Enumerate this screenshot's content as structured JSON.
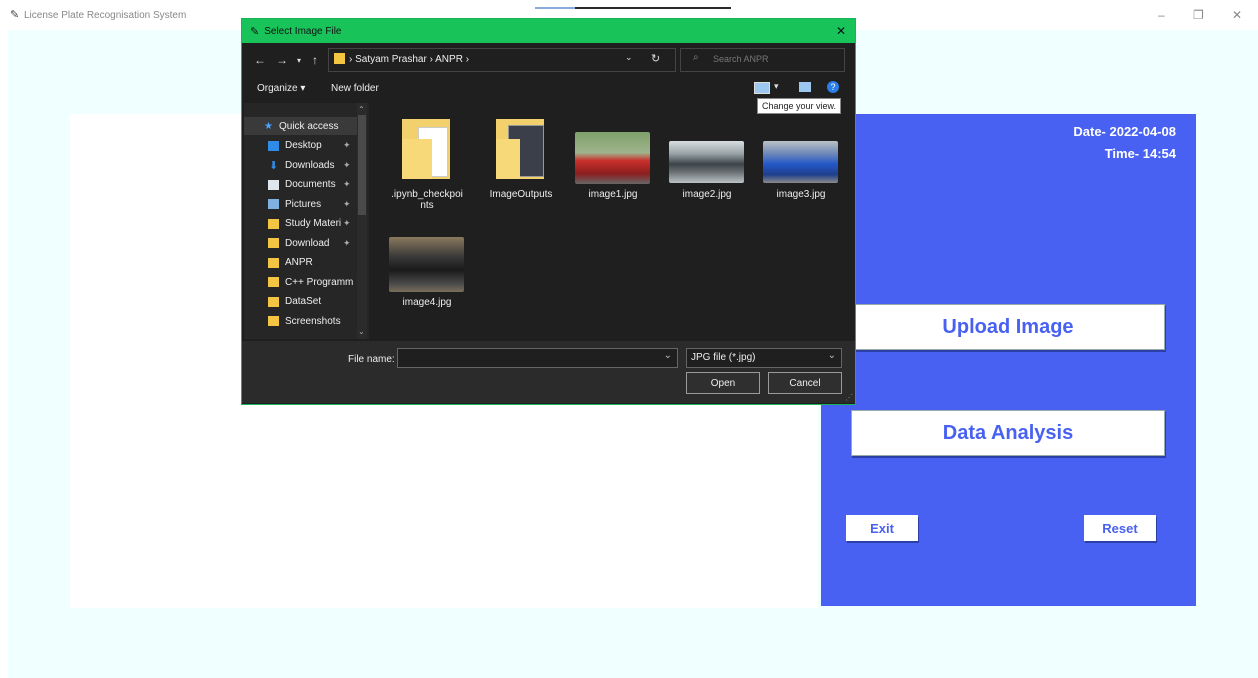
{
  "app": {
    "title": "License Plate Recognisation System",
    "win_controls": {
      "minimize": "–",
      "maximize": "❐",
      "close": "✕"
    }
  },
  "panel": {
    "date": "Date- 2022-04-08",
    "time": "Time- 14:54",
    "upload_label": "Upload Image",
    "analysis_label": "Data Analysis",
    "exit_label": "Exit",
    "reset_label": "Reset",
    "accent": "#4961f2"
  },
  "dialog": {
    "title": "Select Image File",
    "breadcrumb": "›  Satyam Prashar  ›  ANPR  ›",
    "search_placeholder": "Search ANPR",
    "toolbar": {
      "organize": "Organize ▾",
      "new_folder": "New folder"
    },
    "tooltip": "Change your view.",
    "nav_items": [
      {
        "label": "Quick access",
        "icon": "star-icon"
      },
      {
        "label": "Desktop",
        "icon": "desktop-icon"
      },
      {
        "label": "Downloads",
        "icon": "download-icon"
      },
      {
        "label": "Documents",
        "icon": "document-icon"
      },
      {
        "label": "Pictures",
        "icon": "pictures-icon"
      },
      {
        "label": "Study Materi",
        "icon": "folder-icon"
      },
      {
        "label": "Download",
        "icon": "folder-icon"
      },
      {
        "label": "ANPR",
        "icon": "folder-icon"
      },
      {
        "label": "C++ Programm",
        "icon": "folder-icon"
      },
      {
        "label": "DataSet",
        "icon": "folder-icon"
      },
      {
        "label": "Screenshots",
        "icon": "folder-icon"
      }
    ],
    "files": [
      {
        "name": ".ipynb_checkpoi",
        "name2": "nts",
        "kind": "folder"
      },
      {
        "name": "ImageOutputs",
        "kind": "folder"
      },
      {
        "name": "image1.jpg",
        "kind": "image"
      },
      {
        "name": "image2.jpg",
        "kind": "image"
      },
      {
        "name": "image3.jpg",
        "kind": "image"
      },
      {
        "name": "image4.jpg",
        "kind": "image"
      }
    ],
    "footer": {
      "file_name_label": "File name:",
      "file_name_value": "",
      "file_type": "JPG file (*.jpg)",
      "open_label": "Open",
      "cancel_label": "Cancel"
    }
  }
}
